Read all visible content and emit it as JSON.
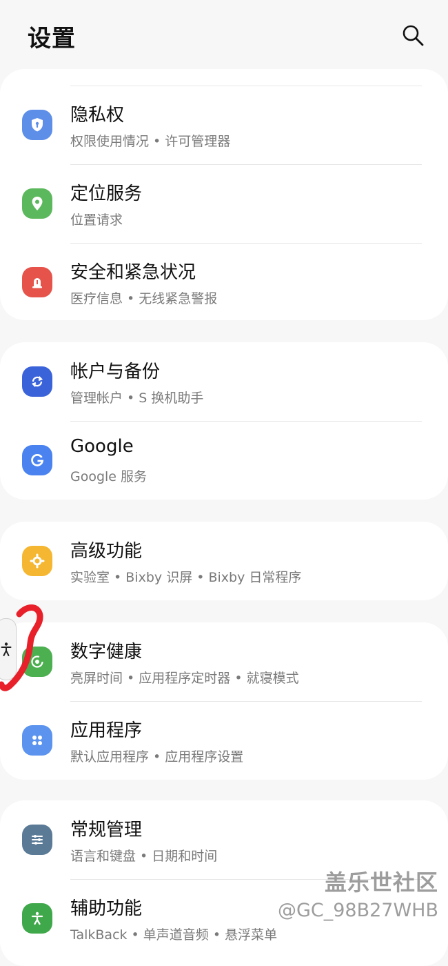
{
  "header": {
    "title": "设置"
  },
  "cards": [
    {
      "items": [
        {
          "title": "隐私权",
          "subtitle": "权限使用情况 • 许可管理器",
          "icon": "privacy-shield-icon",
          "color": "#5d8ee8"
        },
        {
          "title": "定位服务",
          "subtitle": "位置请求",
          "icon": "location-pin-icon",
          "color": "#5cb85c"
        },
        {
          "title": "安全和紧急状况",
          "subtitle": "医疗信息 • 无线紧急警报",
          "icon": "emergency-alert-icon",
          "color": "#e5534b"
        }
      ]
    },
    {
      "items": [
        {
          "title": "帐户与备份",
          "subtitle": "管理帐户 • S 换机助手",
          "icon": "sync-icon",
          "color": "#3b63d9"
        },
        {
          "title": "Google",
          "subtitle": "Google 服务",
          "icon": "google-icon",
          "color": "#4a83f0"
        }
      ]
    },
    {
      "items": [
        {
          "title": "高级功能",
          "subtitle": "实验室 • Bixby 识屏 • Bixby 日常程序",
          "icon": "advanced-features-icon",
          "color": "#f5b731"
        }
      ]
    },
    {
      "items": [
        {
          "title": "数字健康",
          "subtitle": "亮屏时间 • 应用程序定时器 • 就寝模式",
          "icon": "digital-wellbeing-icon",
          "color": "#4caf50"
        },
        {
          "title": "应用程序",
          "subtitle": "默认应用程序 • 应用程序设置",
          "icon": "apps-grid-icon",
          "color": "#5b93ef"
        }
      ]
    },
    {
      "items": [
        {
          "title": "常规管理",
          "subtitle": "语言和键盘 • 日期和时间",
          "icon": "sliders-icon",
          "color": "#5a7a96"
        },
        {
          "title": "辅助功能",
          "subtitle": "TalkBack • 单声道音频 • 悬浮菜单",
          "icon": "accessibility-icon",
          "color": "#3fa84a"
        }
      ]
    }
  ],
  "watermark": {
    "line1": "盖乐世社区",
    "line2": "@GC_98B27WHB"
  }
}
